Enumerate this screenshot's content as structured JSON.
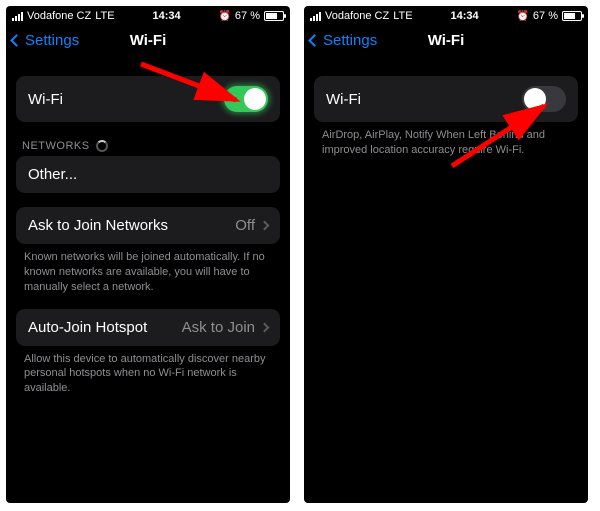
{
  "status": {
    "carrier": "Vodafone CZ",
    "network": "LTE",
    "time": "14:34",
    "alarm_icon": "⏰",
    "battery_pct": "67 %"
  },
  "nav": {
    "back_label": "Settings",
    "title": "Wi-Fi"
  },
  "left": {
    "wifi_row_label": "Wi-Fi",
    "networks_header": "NETWORKS",
    "other_label": "Other...",
    "ask_join": {
      "label": "Ask to Join Networks",
      "value": "Off"
    },
    "ask_join_footer": "Known networks will be joined automatically. If no known networks are available, you will have to manually select a network.",
    "auto_hotspot": {
      "label": "Auto-Join Hotspot",
      "value": "Ask to Join"
    },
    "auto_hotspot_footer": "Allow this device to automatically discover nearby personal hotspots when no Wi-Fi network is available."
  },
  "right": {
    "wifi_row_label": "Wi-Fi",
    "wifi_off_footer": "AirDrop, AirPlay, Notify When Left Behind and improved location accuracy require Wi-Fi."
  },
  "colors": {
    "link_blue": "#0a84ff",
    "toggle_green": "#34c759",
    "cell_bg": "#1c1c1e",
    "secondary_text": "#8e8e93",
    "arrow_red": "#ff0000"
  }
}
